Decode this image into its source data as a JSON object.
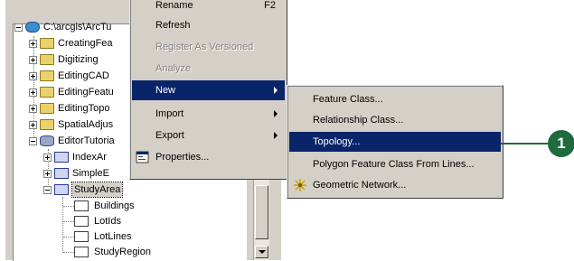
{
  "tree": {
    "root": {
      "label": "C:\\arcgis\\ArcTu"
    },
    "items": [
      {
        "label": "CreatingFea"
      },
      {
        "label": "Digitizing"
      },
      {
        "label": "EditingCAD"
      },
      {
        "label": "EditingFeatu"
      },
      {
        "label": "EditingTopo"
      },
      {
        "label": "SpatialAdjus"
      },
      {
        "label": "EditorTutoria"
      }
    ],
    "children": [
      {
        "label": "IndexAr"
      },
      {
        "label": "SimpleE"
      },
      {
        "label": "StudyArea"
      }
    ],
    "leaves": [
      {
        "label": "Buildings"
      },
      {
        "label": "LotIds"
      },
      {
        "label": "LotLines"
      },
      {
        "label": "StudyRegion"
      }
    ]
  },
  "context_menu": {
    "top_partial": "Rename",
    "top_shortcut": "F2",
    "refresh": "Refresh",
    "register": "Register As Versioned",
    "analyze": "Analyze",
    "new": "New",
    "import": "Import",
    "export": "Export",
    "properties": "Properties..."
  },
  "submenu": {
    "feature_class": "Feature Class...",
    "relationship_class": "Relationship Class...",
    "topology": "Topology...",
    "polygon_from_lines": "Polygon Feature Class From Lines...",
    "geometric_network": "Geometric Network..."
  },
  "callout": {
    "number": "1"
  },
  "colors": {
    "highlight": "#0a246a",
    "callout": "#1f6b3d",
    "menu_bg": "#d4d0c8"
  }
}
